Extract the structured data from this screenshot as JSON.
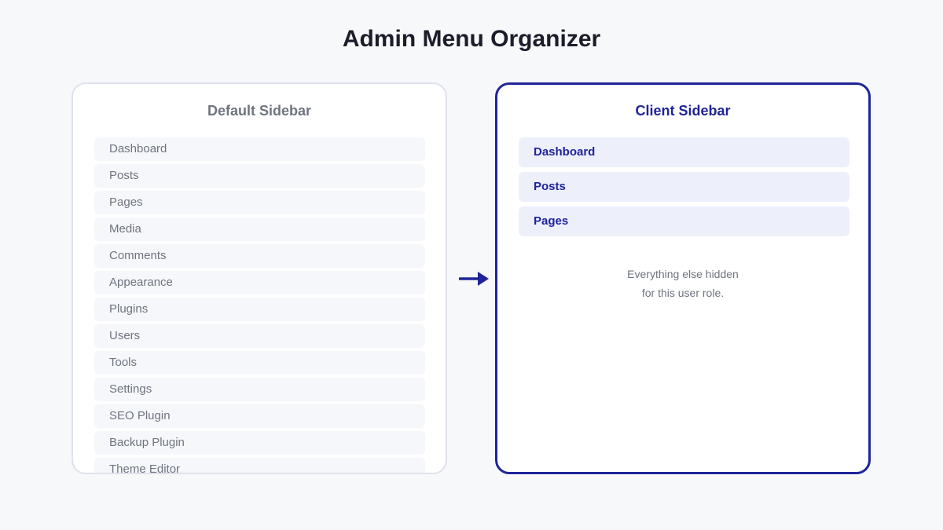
{
  "title": "Admin Menu Organizer",
  "colors": {
    "accent": "#1f2499",
    "muted_text": "#6f7480",
    "client_item_bg": "#edeffb",
    "default_item_bg": "#f6f7fa"
  },
  "default_sidebar": {
    "title": "Default Sidebar",
    "items": [
      "Dashboard",
      "Posts",
      "Pages",
      "Media",
      "Comments",
      "Appearance",
      "Plugins",
      "Users",
      "Tools",
      "Settings",
      "SEO Plugin",
      "Backup Plugin",
      "Theme Editor"
    ]
  },
  "arrow_icon": "arrow-right-icon",
  "client_sidebar": {
    "title": "Client Sidebar",
    "items": [
      "Dashboard",
      "Posts",
      "Pages"
    ],
    "note_line1": "Everything else hidden",
    "note_line2": "for this user role."
  }
}
